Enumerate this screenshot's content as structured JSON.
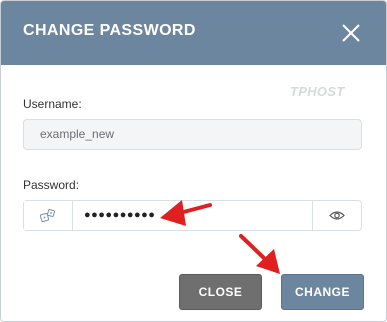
{
  "dialog": {
    "title": "CHANGE PASSWORD",
    "brand_logo": "TPHOST",
    "close_icon": "close-icon"
  },
  "form": {
    "username_label": "Username:",
    "username_value": "example_new",
    "password_label": "Password:",
    "password_value": "●●●●●●●●●●",
    "generate_icon": "dice-icon",
    "show_password_icon": "eye-icon"
  },
  "buttons": {
    "close_label": "CLOSE",
    "change_label": "CHANGE"
  },
  "annotations": {
    "arrow_color": "#e02020"
  },
  "colors": {
    "header": "#6c86a0",
    "close_button": "#6f6f6f",
    "change_button": "#6c86a0"
  }
}
